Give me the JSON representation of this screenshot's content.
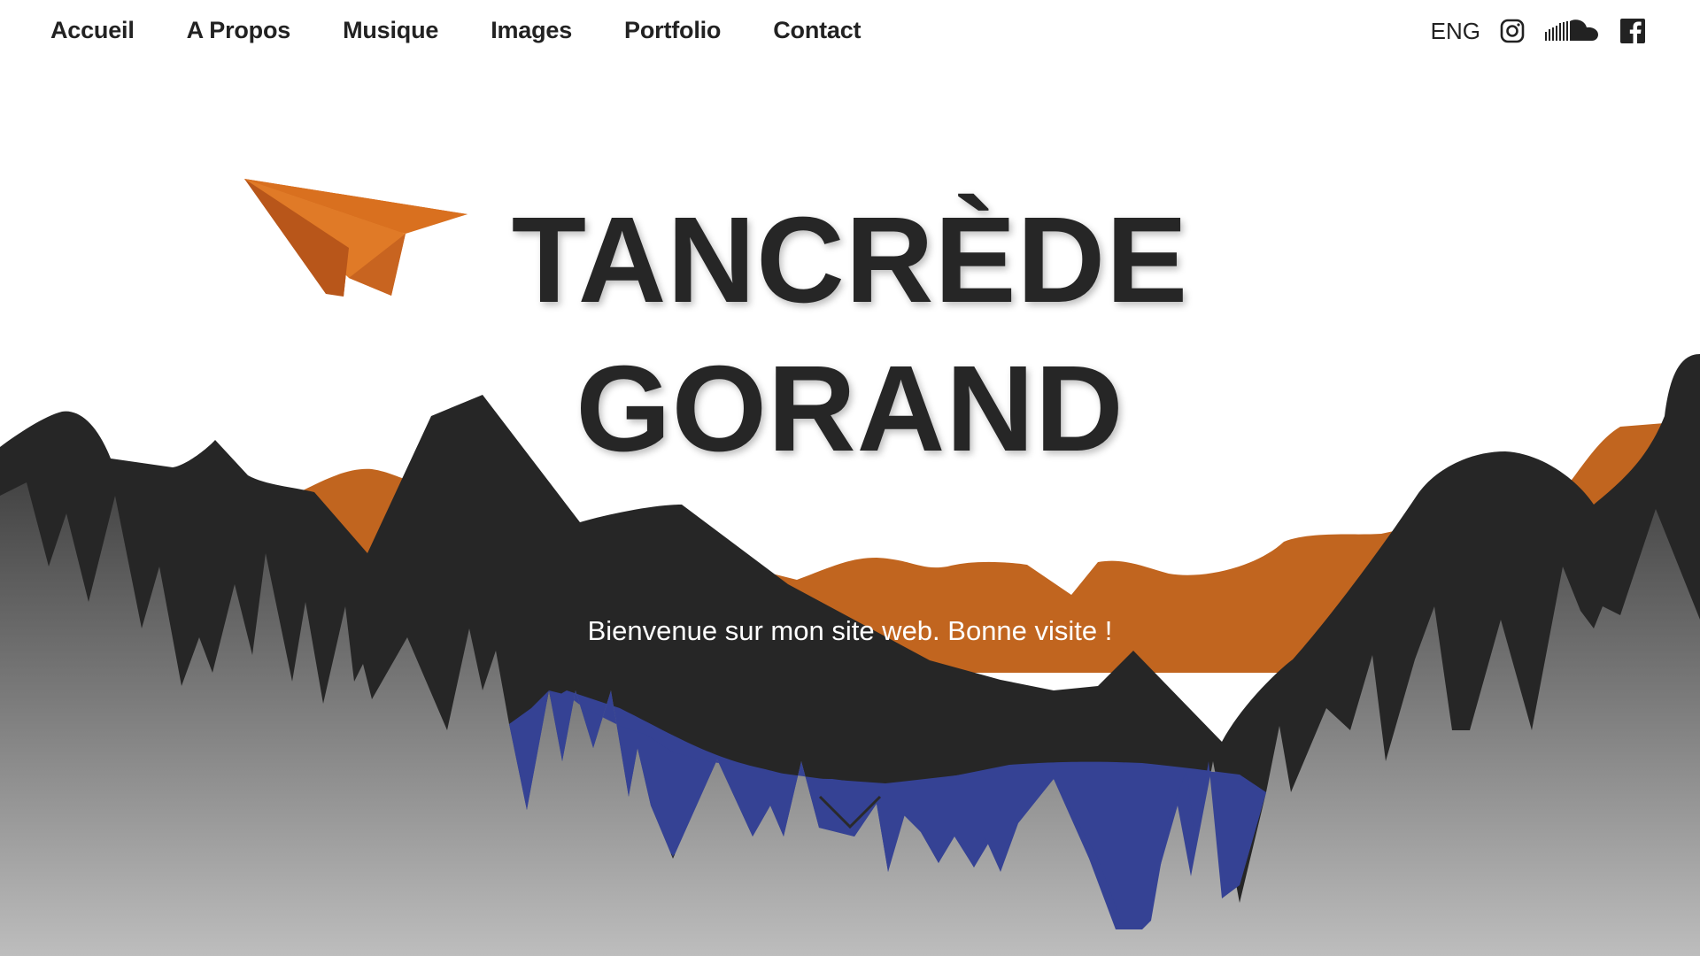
{
  "nav": {
    "items": [
      {
        "label": "Accueil"
      },
      {
        "label": "A Propos"
      },
      {
        "label": "Musique"
      },
      {
        "label": "Images"
      },
      {
        "label": "Portfolio"
      },
      {
        "label": "Contact"
      }
    ],
    "language": "ENG",
    "social": [
      "instagram-icon",
      "soundcloud-icon",
      "facebook-icon"
    ]
  },
  "hero": {
    "title_line1": "TANCRÈDE",
    "title_line2": "GORAND",
    "welcome": "Bienvenue sur mon site web. Bonne visite !"
  },
  "colors": {
    "text_dark": "#262626",
    "mountain_dark": "#262626",
    "mountain_orange": "#c1651f",
    "lake_blue": "#354294",
    "plane_orange": "#d9701f"
  }
}
